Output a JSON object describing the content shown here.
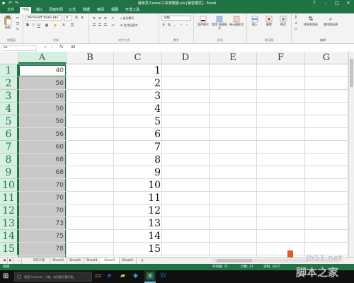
{
  "window": {
    "title": "最新员工excel工资表模板.xls [兼容模式] - Excel"
  },
  "tabs": [
    "文件",
    "开始",
    "插入",
    "页面布局",
    "公式",
    "数据",
    "审阅",
    "视图",
    "开发工具"
  ],
  "ribbon": {
    "paste_label": "粘贴",
    "font_name": "Microsoft YaHei (Bo",
    "font_size": "9",
    "wrap_text": "自动换行",
    "merge_center": "合并后居中",
    "number_format": "常规",
    "cond_format": "条件格式",
    "table_format": "套用\n表格格式",
    "cell_style": "单元格样式",
    "insert": "插入",
    "delete": "删除",
    "format": "格式",
    "sort_filter": "排序和筛选",
    "find_select": "查找和选择",
    "groups": [
      "剪贴板",
      "字体",
      "对齐方式",
      "数字",
      "样式",
      "单元格",
      "编辑"
    ]
  },
  "formula_bar": {
    "name_box": "A1",
    "fx": "fx",
    "value": "40"
  },
  "grid": {
    "columns": [
      "A",
      "B",
      "C",
      "D",
      "E",
      "F",
      "G"
    ],
    "selected_column": "A",
    "rows": [
      {
        "row": "1",
        "a": "40",
        "c": "1"
      },
      {
        "row": "2",
        "a": "50",
        "c": "2"
      },
      {
        "row": "3",
        "a": "50",
        "c": "3"
      },
      {
        "row": "4",
        "a": "50",
        "c": "4"
      },
      {
        "row": "5",
        "a": "50",
        "c": "5"
      },
      {
        "row": "6",
        "a": "56",
        "c": "6"
      },
      {
        "row": "7",
        "a": "60",
        "c": "7"
      },
      {
        "row": "8",
        "a": "68",
        "c": "8"
      },
      {
        "row": "9",
        "a": "68",
        "c": "9"
      },
      {
        "row": "10",
        "a": "70",
        "c": "10"
      },
      {
        "row": "11",
        "a": "70",
        "c": "11"
      },
      {
        "row": "12",
        "a": "70",
        "c": "12"
      },
      {
        "row": "13",
        "a": "73",
        "c": "13"
      },
      {
        "row": "14",
        "a": "75",
        "c": "14"
      },
      {
        "row": "15",
        "a": "78",
        "c": "15"
      }
    ]
  },
  "sheets": [
    "5月工资",
    "Sheet3",
    "Sheet4",
    "Sheet1",
    "Sheet5",
    "Sheet2"
  ],
  "active_sheet": "Sheet5",
  "add_sheet": "+",
  "status": {
    "ready": "就绪",
    "average": "平均值: 71",
    "count": "计数: 27",
    "sum": "求和: 1917"
  },
  "taskbar": {
    "search_placeholder": "我是 Cortana，小娜。有问题尽管问我。"
  },
  "watermark": {
    "site": "jb51.net",
    "brand": "脚本之家"
  },
  "colors": {
    "excel_green": "#217346",
    "selection_grey": "#c8c8c8",
    "header_highlight": "#d3f0e0"
  }
}
